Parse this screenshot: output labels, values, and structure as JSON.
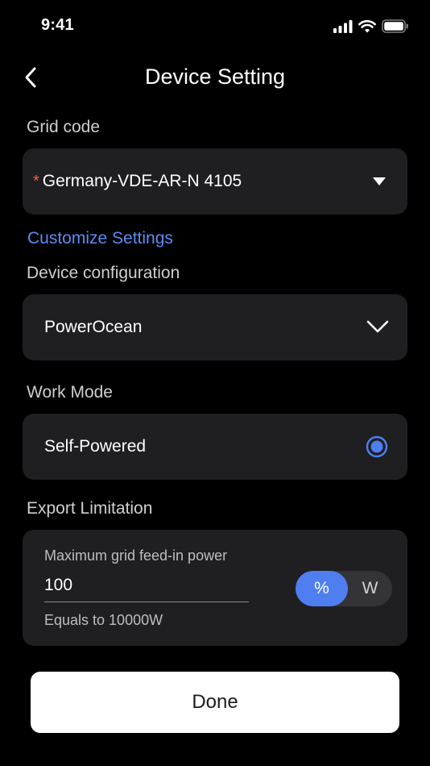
{
  "status_bar": {
    "time": "9:41"
  },
  "header": {
    "title": "Device Setting"
  },
  "grid_code": {
    "label": "Grid code",
    "required_mark": "*",
    "value": "Germany-VDE-AR-N 4105"
  },
  "customize_link": "Customize Settings",
  "device_configuration": {
    "label": "Device configuration",
    "value": "PowerOcean"
  },
  "work_mode": {
    "label": "Work Mode",
    "value": "Self-Powered",
    "selected": true
  },
  "export_limitation": {
    "label": "Export Limitation",
    "field_label": "Maximum grid feed-in power",
    "field_value": "100",
    "hint": "Equals to 10000W",
    "unit_percent": "%",
    "unit_watt": "W",
    "selected_unit": "%"
  },
  "done_button": "Done",
  "colors": {
    "background": "#000000",
    "card": "#1f1f21",
    "accent": "#4f7ef0",
    "link": "#5b8cf5",
    "required": "#ff5a3d"
  }
}
